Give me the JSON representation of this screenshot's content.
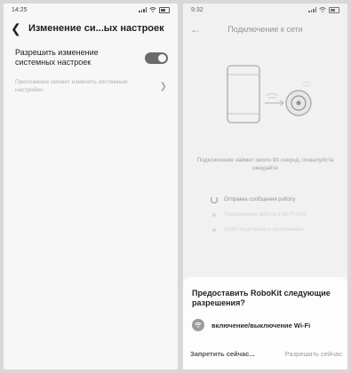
{
  "left": {
    "status": {
      "time": "14:25"
    },
    "header": {
      "title": "Изменение си...ых настроек"
    },
    "toggle_row": {
      "label": "Разрешить изменение системных настроек",
      "enabled": true
    },
    "description": "Приложение сможет изменять системные настройки."
  },
  "right": {
    "status": {
      "time": "9:32"
    },
    "header": {
      "title": "Подключение к сети"
    },
    "wait_message": "Подключение займет около 90 секунд, пожалуйста ожидайте",
    "steps": [
      {
        "label": "Отправка сообщения роботу",
        "state": "active"
      },
      {
        "label": "Подключение робота к Wi-Fi сети",
        "state": "pending"
      },
      {
        "label": "Робот подключен к приложению",
        "state": "pending"
      }
    ],
    "permission_sheet": {
      "title": "Предоставить RoboKit следующие разрешения?",
      "permission": "включение/выключение Wi-Fi",
      "deny_label": "Запретить сейчас...",
      "allow_label": "Разрешить сейчас"
    }
  },
  "colors": {
    "toggle_on": "#6b6b6b",
    "sheet_bg": "#fdfdfd",
    "screen_bg": "#eeeeee"
  },
  "icons": [
    "back-arrow-icon",
    "chevron-right-icon",
    "signal-icon",
    "wifi-icon",
    "battery-icon",
    "phone-icon",
    "robot-icon",
    "spinner-icon"
  ]
}
